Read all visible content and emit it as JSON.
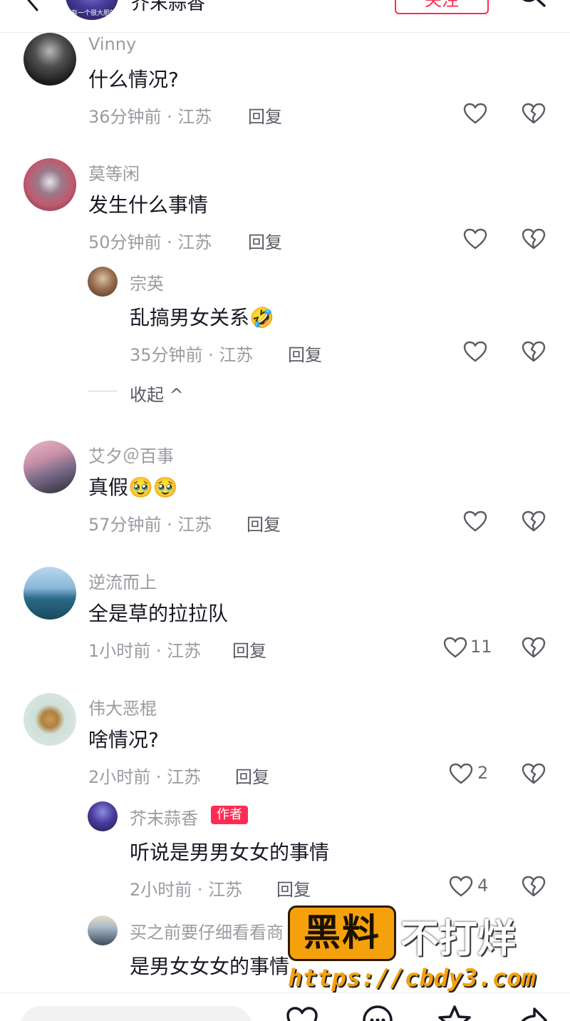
{
  "header": {
    "avatar_caption": "有一个很大胆的想",
    "author_name": "芥末蒜香",
    "follow_label": "关注"
  },
  "comments": [
    {
      "user": "Vinny",
      "text": "什么情况?",
      "meta": "36分钟前 · 江苏",
      "reply_label": "回复",
      "likes": ""
    },
    {
      "user": "莫等闲",
      "text": "发生什么事情",
      "meta": "50分钟前 · 江苏",
      "reply_label": "回复",
      "likes": ""
    },
    {
      "user": "艾夕＠百事",
      "text": "真假",
      "emoji": "🥹🥹",
      "meta": "57分钟前 · 江苏",
      "reply_label": "回复",
      "likes": ""
    },
    {
      "user": "逆流而上",
      "text": "全是草的拉拉队",
      "meta": "1小时前 · 江苏",
      "reply_label": "回复",
      "likes": "11"
    },
    {
      "user": "伟大恶棍",
      "text": "啥情况?",
      "meta": "2小时前 · 江苏",
      "reply_label": "回复",
      "likes": "2"
    }
  ],
  "replies": [
    {
      "user": "宗英",
      "text": "乱搞男女关系",
      "emoji": "🤣",
      "meta": "35分钟前 · 江苏",
      "reply_label": "回复",
      "likes": ""
    },
    {
      "user": "芥末蒜香",
      "badge": "作者",
      "text": "听说是男男女女的事情",
      "meta": "2小时前 · 江苏",
      "reply_label": "回复",
      "likes": "4"
    },
    {
      "user": "买之前要仔细看看商",
      "text": "是男女女女的事情"
    }
  ],
  "collapse_label": "收起 ^",
  "watermark": {
    "box_text": "黑料",
    "right_text": "不打烊",
    "url": "https://cbdy3.com"
  },
  "colors": {
    "accent": "#fe2c55",
    "watermark_orange": "#f5a10c",
    "muted_text": "#9a9ba1"
  }
}
